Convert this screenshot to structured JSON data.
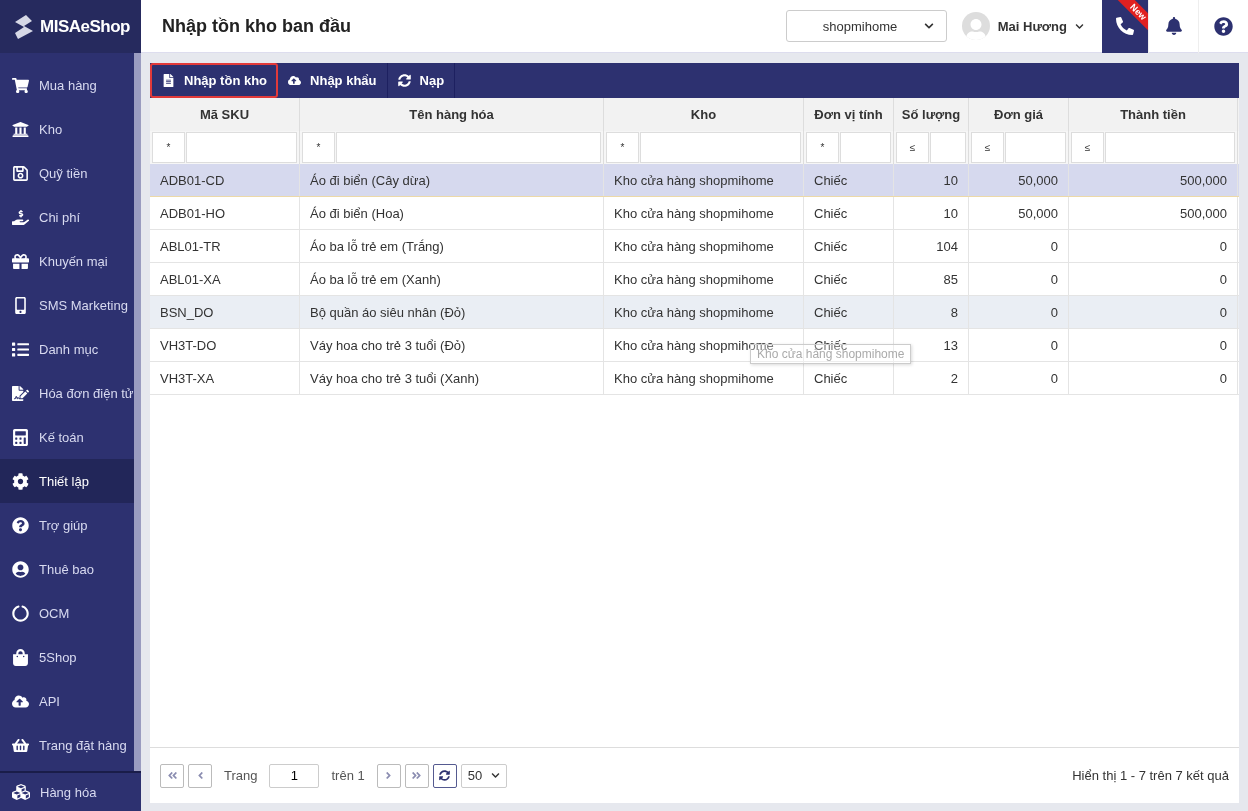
{
  "sidebar": {
    "logo": "MISAeShop",
    "items": [
      {
        "label": "Mua hàng",
        "selected": false
      },
      {
        "label": "Kho",
        "selected": false
      },
      {
        "label": "Quỹ tiền",
        "selected": false
      },
      {
        "label": "Chi phí",
        "selected": false
      },
      {
        "label": "Khuyến mại",
        "selected": false
      },
      {
        "label": "SMS Marketing",
        "selected": false
      },
      {
        "label": "Danh mục",
        "selected": false
      },
      {
        "label": "Hóa đơn điện tử",
        "selected": false
      },
      {
        "label": "Kế toán",
        "selected": false
      },
      {
        "label": "Thiết lập",
        "selected": true
      },
      {
        "label": "Trợ giúp",
        "selected": false
      },
      {
        "label": "Thuê bao",
        "selected": false
      },
      {
        "label": "OCM",
        "selected": false
      },
      {
        "label": "5Shop",
        "selected": false
      },
      {
        "label": "API",
        "selected": false
      },
      {
        "label": "Trang đặt hàng",
        "selected": false
      }
    ],
    "bottom_item": {
      "label": "Hàng hóa"
    }
  },
  "header": {
    "title": "Nhập tồn kho ban đầu",
    "store": "shopmihome",
    "user": "Mai Hương",
    "badge": "New"
  },
  "toolbar": [
    {
      "label": "Nhập tồn kho",
      "selected": true
    },
    {
      "label": "Nhập khẩu",
      "selected": false
    },
    {
      "label": "Nạp",
      "selected": false
    }
  ],
  "table": {
    "columns": [
      {
        "title": "Mã SKU",
        "filter_op": "*",
        "kind": "text"
      },
      {
        "title": "Tên hàng hóa",
        "filter_op": "*",
        "kind": "text"
      },
      {
        "title": "Kho",
        "filter_op": "*",
        "kind": "text"
      },
      {
        "title": "Đơn vị tính",
        "filter_op": "*",
        "kind": "text"
      },
      {
        "title": "Số lượng",
        "filter_op": "≤",
        "kind": "number"
      },
      {
        "title": "Đơn giá",
        "filter_op": "≤",
        "kind": "number"
      },
      {
        "title": "Thành tiền",
        "filter_op": "≤",
        "kind": "number"
      }
    ],
    "rows": [
      {
        "selected": true,
        "hovered": false,
        "cells": [
          "ADB01-CD",
          "Áo đi biển (Cây dừa)",
          "Kho cửa hàng shopmihome",
          "Chiếc",
          "10",
          "50,000",
          "500,000"
        ]
      },
      {
        "selected": false,
        "hovered": false,
        "cells": [
          "ADB01-HO",
          "Áo đi biển (Hoa)",
          "Kho cửa hàng shopmihome",
          "Chiếc",
          "10",
          "50,000",
          "500,000"
        ]
      },
      {
        "selected": false,
        "hovered": false,
        "cells": [
          "ABL01-TR",
          "Áo ba lỗ trẻ em (Trắng)",
          "Kho cửa hàng shopmihome",
          "Chiếc",
          "104",
          "0",
          "0"
        ]
      },
      {
        "selected": false,
        "hovered": false,
        "cells": [
          "ABL01-XA",
          "Áo ba lỗ trẻ em (Xanh)",
          "Kho cửa hàng shopmihome",
          "Chiếc",
          "85",
          "0",
          "0"
        ]
      },
      {
        "selected": false,
        "hovered": true,
        "cells": [
          "BSN_DO",
          "Bộ quần áo siêu nhân (Đỏ)",
          "Kho cửa hàng shopmihome",
          "Chiếc",
          "8",
          "0",
          "0"
        ]
      },
      {
        "selected": false,
        "hovered": false,
        "cells": [
          "VH3T-DO",
          "Váy hoa cho trẻ 3 tuổi (Đỏ)",
          "Kho cửa hàng shopmihome",
          "Chiếc",
          "13",
          "0",
          "0"
        ]
      },
      {
        "selected": false,
        "hovered": false,
        "cells": [
          "VH3T-XA",
          "Váy hoa cho trẻ 3 tuổi (Xanh)",
          "Kho cửa hàng shopmihome",
          "Chiếc",
          "2",
          "0",
          "0"
        ]
      }
    ],
    "tooltip": "Kho cửa hàng shopmihome"
  },
  "pager": {
    "page_label": "Trang",
    "page": "1",
    "of": "trên 1",
    "page_size": "50",
    "summary": "Hiển thị 1 - 7 trên 7 kết quả"
  }
}
